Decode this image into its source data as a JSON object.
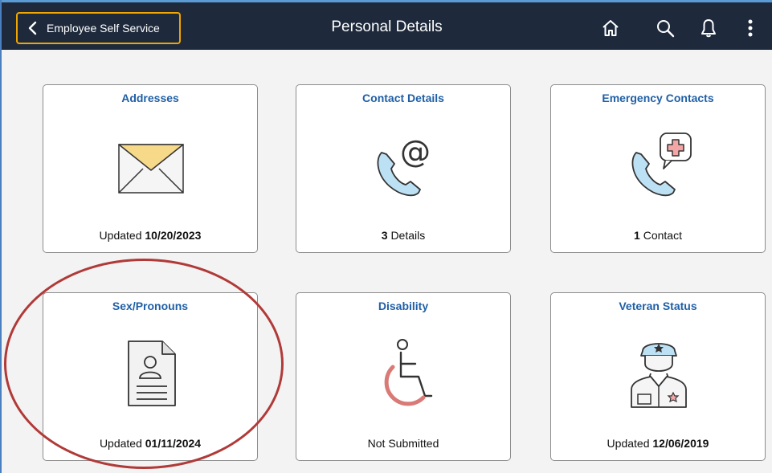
{
  "header": {
    "back_label": "Employee Self Service",
    "title": "Personal Details",
    "icons": [
      "home-icon",
      "search-icon",
      "notification-bell-icon",
      "more-actions-icon"
    ]
  },
  "tiles": [
    {
      "title": "Addresses",
      "icon": "envelope-icon",
      "footer_prefix": "Updated",
      "footer_value": "10/20/2023",
      "footer_suffix": ""
    },
    {
      "title": "Contact Details",
      "icon": "phone-at-icon",
      "footer_prefix": "",
      "footer_value": "3",
      "footer_suffix": "Details"
    },
    {
      "title": "Emergency Contacts",
      "icon": "phone-medical-icon",
      "footer_prefix": "",
      "footer_value": "1",
      "footer_suffix": "Contact"
    },
    {
      "title": "Sex/Pronouns",
      "icon": "profile-document-icon",
      "footer_prefix": "Updated",
      "footer_value": "01/11/2024",
      "footer_suffix": ""
    },
    {
      "title": "Disability",
      "icon": "wheelchair-icon",
      "footer_prefix": "",
      "footer_value": "",
      "footer_suffix": "Not Submitted"
    },
    {
      "title": "Veteran Status",
      "icon": "veteran-officer-icon",
      "footer_prefix": "Updated",
      "footer_value": "12/06/2019",
      "footer_suffix": ""
    }
  ],
  "colors": {
    "header_bg": "#1e2a3c",
    "focus_outline": "#f0a500",
    "tile_title": "#1f5fa6",
    "annotation_circle": "#b03a38"
  }
}
